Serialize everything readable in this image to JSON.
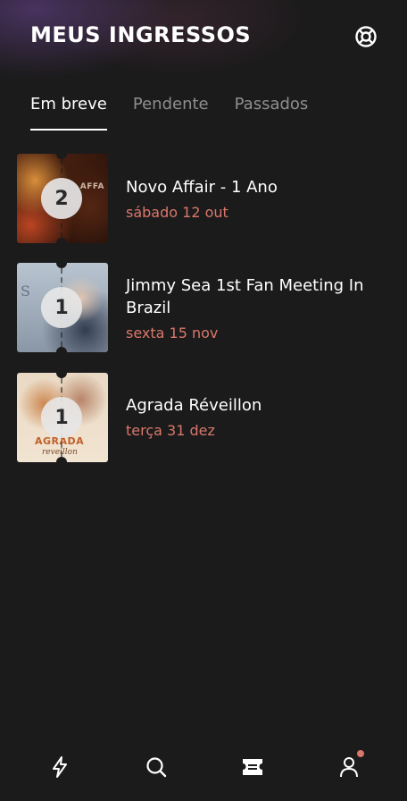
{
  "header": {
    "title": "MEUS INGRESSOS",
    "help_icon": "lifebuoy-icon"
  },
  "tabs": [
    {
      "label": "Em breve",
      "active": true
    },
    {
      "label": "Pendente",
      "active": false
    },
    {
      "label": "Passados",
      "active": false
    }
  ],
  "tickets": [
    {
      "name": "Novo Affair - 1 Ano",
      "date": "sábado 12 out",
      "quantity": "2",
      "art_text": "AFFA"
    },
    {
      "name": "Jimmy Sea 1st Fan Meeting In Brazil",
      "date": "sexta 15 nov",
      "quantity": "1",
      "art_text": "S"
    },
    {
      "name": "Agrada Réveillon",
      "date": "terça 31 dez",
      "quantity": "1",
      "art_text": "AGRADA",
      "art_sub": "reveillon"
    }
  ],
  "bottom_nav": [
    {
      "icon": "lightning-icon",
      "active": false
    },
    {
      "icon": "search-icon",
      "active": false
    },
    {
      "icon": "ticket-icon",
      "active": true
    },
    {
      "icon": "user-icon",
      "active": false,
      "badge": true
    }
  ],
  "colors": {
    "background": "#1c1b1c",
    "accent_date": "#d9776a",
    "tab_inactive": "#8f8d90"
  }
}
